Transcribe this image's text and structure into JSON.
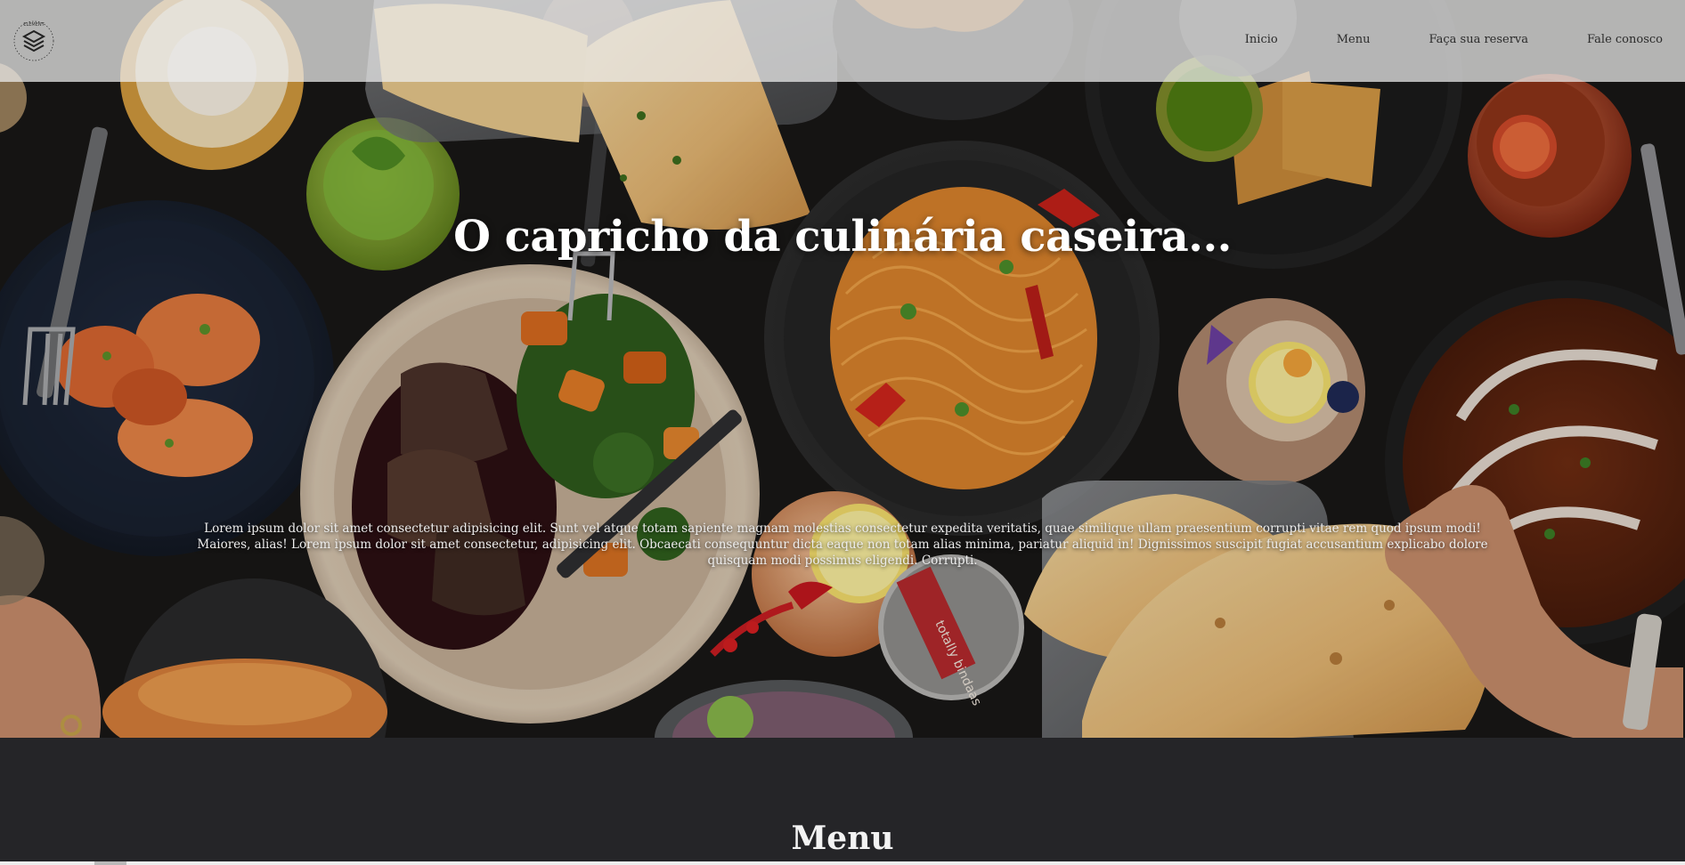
{
  "header": {
    "logo_text": "ELEMENT",
    "nav": [
      {
        "label": "Inicio"
      },
      {
        "label": "Menu"
      },
      {
        "label": "Faça sua reserva"
      },
      {
        "label": "Fale conosco"
      }
    ]
  },
  "hero": {
    "title": "O capricho da culinária caseira...",
    "text": "Lorem ipsum dolor sit amet consectetur adipisicing elit. Sunt vel atque totam sapiente magnam molestias consectetur expedita veritatis, quae similique ullam praesentium corrupti vitae rem quod ipsum modi! Maiores, alias! Lorem ipsum dolor sit amet consectetur, adipisicing elit. Obcaecati consequuntur dicta eaque non totam alias minima, pariatur aliquid in! Dignissimos suscipit fugiat accusantium explicabo dolore quisquam modi possimus eligendi. Corrupti.",
    "coaster_text": "totally bindaas"
  },
  "menu_section": {
    "heading": "Menu"
  },
  "colors": {
    "header_bg": "#ececec",
    "page_bg": "#252528",
    "title_color": "#ffffff"
  }
}
